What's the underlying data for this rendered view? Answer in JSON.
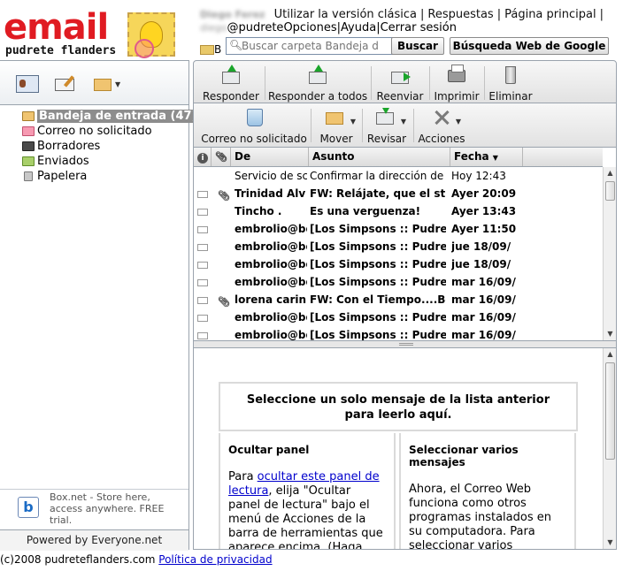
{
  "brand": {
    "logo_word": "email",
    "logo_sub": "pudrete flanders"
  },
  "header": {
    "user_name": "Diego Ferez",
    "user_email_prefix": "diego",
    "email_domain": "@pudrete",
    "links": [
      "Utilizar la versión clásica",
      "Respuestas",
      "Página principal"
    ],
    "links2": [
      "Opciones",
      "Ayuda",
      "Cerrar sesión"
    ],
    "search_placeholder": "Buscar carpeta Bandeja d",
    "search_button": "Buscar",
    "web_search_button": "Búsqueda Web de Google",
    "crumb_letter": "B"
  },
  "folders": [
    {
      "label": "Bandeja de entrada (47)",
      "icon": "inbox-folder-icon",
      "selected": true
    },
    {
      "label": "Correo no solicitado",
      "icon": "spam-folder-icon"
    },
    {
      "label": "Borradores",
      "icon": "drafts-folder-icon"
    },
    {
      "label": "Enviados",
      "icon": "sent-folder-icon"
    },
    {
      "label": "Papelera",
      "icon": "trash-folder-icon"
    }
  ],
  "promo": {
    "logo_letter": "b",
    "text": "Box.net - Store here, access anywhere. FREE trial."
  },
  "powered_by": "Powered by Everyone.net",
  "toolbar1": [
    "Responder",
    "Responder a todos",
    "Reenviar",
    "Imprimir",
    "Eliminar"
  ],
  "toolbar2": [
    "Correo no solicitado",
    "Mover",
    "Revisar",
    "Acciones"
  ],
  "list_headers": {
    "from": "De",
    "subject": "Asunto",
    "date": "Fecha"
  },
  "messages": [
    {
      "from": "Servicio de sc",
      "subject": "Confirmar la dirección de c",
      "date": "Hoy 12:43",
      "unread": false,
      "env": false,
      "clip": false
    },
    {
      "from": "Trinidad Alv",
      "subject": "FW: Relájate, que el stre",
      "date": "Ayer 20:09",
      "unread": true,
      "env": true,
      "clip": true
    },
    {
      "from": "Tincho .",
      "subject": "Es una verguenza!",
      "date": "Ayer 13:43",
      "unread": true,
      "env": true,
      "clip": false
    },
    {
      "from": "embrolio@bo",
      "subject": "[Los Simpsons :: Pudret",
      "date": "Ayer 11:50",
      "unread": true,
      "env": true,
      "clip": false
    },
    {
      "from": "embrolio@bo",
      "subject": "[Los Simpsons :: Pudret",
      "date": "jue 18/09/",
      "unread": true,
      "env": true,
      "clip": false
    },
    {
      "from": "embrolio@bo",
      "subject": "[Los Simpsons :: Pudret",
      "date": "jue 18/09/",
      "unread": true,
      "env": true,
      "clip": false
    },
    {
      "from": "embrolio@bo",
      "subject": "[Los Simpsons :: Pudret",
      "date": "mar 16/09/",
      "unread": true,
      "env": true,
      "clip": false
    },
    {
      "from": "lorena carin",
      "subject": "FW: Con el Tiempo....Bo",
      "date": "mar 16/09/",
      "unread": true,
      "env": true,
      "clip": true
    },
    {
      "from": "embrolio@bo",
      "subject": "[Los Simpsons :: Pudret",
      "date": "mar 16/09/",
      "unread": true,
      "env": true,
      "clip": false
    },
    {
      "from": "embrolio@bo",
      "subject": "[Los Simpsons :: Pudret",
      "date": "mar 16/09/",
      "unread": true,
      "env": true,
      "clip": false
    }
  ],
  "reading": {
    "title": "Seleccione un solo mensaje de la lista anterior para leerlo aquí.",
    "left_heading": "Ocultar panel",
    "left_pre": "Para ",
    "left_link": "ocultar este panel de lectura",
    "left_post": ", elija \"Ocultar panel de lectura\" bajo el menú de Acciones de la barra de herramientas que aparece encima. (Haga",
    "right_heading": "Seleccionar varios mensajes",
    "right_text": "Ahora, el Correo Web funciona como otros programas instalados en su computadora. Para seleccionar varios"
  },
  "footer": {
    "copyright": "(c)2008 pudreteflanders.com",
    "privacy": "Política de privacidad"
  },
  "colors": {
    "logo_red": "#e01b22",
    "link_blue": "#0000cc",
    "selected_folder": "#8d8d8d",
    "icon_green": "#1aa52b"
  }
}
